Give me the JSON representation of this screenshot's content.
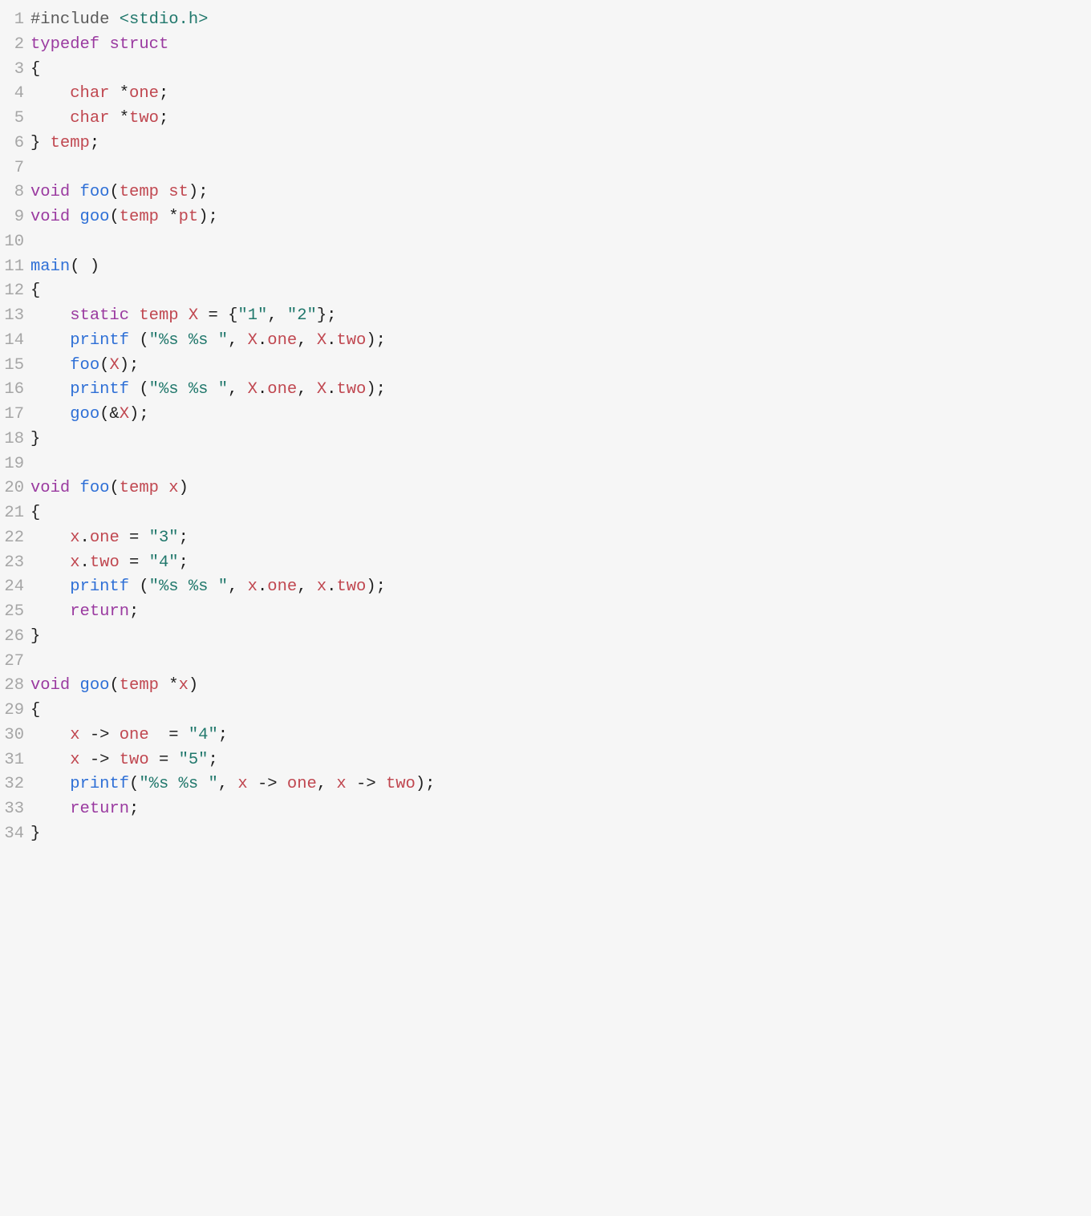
{
  "code": {
    "lines": [
      {
        "n": "1",
        "tokens": [
          [
            "preproc",
            "#include"
          ],
          [
            "punct",
            " "
          ],
          [
            "include",
            "<stdio.h>"
          ]
        ]
      },
      {
        "n": "2",
        "tokens": [
          [
            "keyword",
            "typedef"
          ],
          [
            "punct",
            " "
          ],
          [
            "keyword",
            "struct"
          ]
        ]
      },
      {
        "n": "3",
        "tokens": [
          [
            "punct",
            "{"
          ]
        ]
      },
      {
        "n": "4",
        "tokens": [
          [
            "punct",
            "    "
          ],
          [
            "type",
            "char"
          ],
          [
            "punct",
            " *"
          ],
          [
            "var",
            "one"
          ],
          [
            "punct",
            ";"
          ]
        ]
      },
      {
        "n": "5",
        "tokens": [
          [
            "punct",
            "    "
          ],
          [
            "type",
            "char"
          ],
          [
            "punct",
            " *"
          ],
          [
            "var",
            "two"
          ],
          [
            "punct",
            ";"
          ]
        ]
      },
      {
        "n": "6",
        "tokens": [
          [
            "punct",
            "} "
          ],
          [
            "type",
            "temp"
          ],
          [
            "punct",
            ";"
          ]
        ]
      },
      {
        "n": "7",
        "tokens": []
      },
      {
        "n": "8",
        "tokens": [
          [
            "keyword",
            "void"
          ],
          [
            "punct",
            " "
          ],
          [
            "func",
            "foo"
          ],
          [
            "punct",
            "("
          ],
          [
            "type",
            "temp"
          ],
          [
            "punct",
            " "
          ],
          [
            "var",
            "st"
          ],
          [
            "punct",
            ");"
          ]
        ]
      },
      {
        "n": "9",
        "tokens": [
          [
            "keyword",
            "void"
          ],
          [
            "punct",
            " "
          ],
          [
            "func",
            "goo"
          ],
          [
            "punct",
            "("
          ],
          [
            "type",
            "temp"
          ],
          [
            "punct",
            " *"
          ],
          [
            "var",
            "pt"
          ],
          [
            "punct",
            ");"
          ]
        ]
      },
      {
        "n": "10",
        "tokens": []
      },
      {
        "n": "11",
        "tokens": [
          [
            "func",
            "main"
          ],
          [
            "punct",
            "( )"
          ]
        ]
      },
      {
        "n": "12",
        "tokens": [
          [
            "punct",
            "{"
          ]
        ]
      },
      {
        "n": "13",
        "tokens": [
          [
            "punct",
            "    "
          ],
          [
            "keyword",
            "static"
          ],
          [
            "punct",
            " "
          ],
          [
            "type",
            "temp"
          ],
          [
            "punct",
            " "
          ],
          [
            "var",
            "X"
          ],
          [
            "punct",
            " = {"
          ],
          [
            "string",
            "\"1\""
          ],
          [
            "punct",
            ", "
          ],
          [
            "string",
            "\"2\""
          ],
          [
            "punct",
            "};"
          ]
        ]
      },
      {
        "n": "14",
        "tokens": [
          [
            "punct",
            "    "
          ],
          [
            "func",
            "printf"
          ],
          [
            "punct",
            " ("
          ],
          [
            "string",
            "\"%s %s \""
          ],
          [
            "punct",
            ", "
          ],
          [
            "var",
            "X"
          ],
          [
            "punct",
            "."
          ],
          [
            "var",
            "one"
          ],
          [
            "punct",
            ", "
          ],
          [
            "var",
            "X"
          ],
          [
            "punct",
            "."
          ],
          [
            "var",
            "two"
          ],
          [
            "punct",
            ");"
          ]
        ]
      },
      {
        "n": "15",
        "tokens": [
          [
            "punct",
            "    "
          ],
          [
            "func",
            "foo"
          ],
          [
            "punct",
            "("
          ],
          [
            "var",
            "X"
          ],
          [
            "punct",
            ");"
          ]
        ]
      },
      {
        "n": "16",
        "tokens": [
          [
            "punct",
            "    "
          ],
          [
            "func",
            "printf"
          ],
          [
            "punct",
            " ("
          ],
          [
            "string",
            "\"%s %s \""
          ],
          [
            "punct",
            ", "
          ],
          [
            "var",
            "X"
          ],
          [
            "punct",
            "."
          ],
          [
            "var",
            "one"
          ],
          [
            "punct",
            ", "
          ],
          [
            "var",
            "X"
          ],
          [
            "punct",
            "."
          ],
          [
            "var",
            "two"
          ],
          [
            "punct",
            ");"
          ]
        ]
      },
      {
        "n": "17",
        "tokens": [
          [
            "punct",
            "    "
          ],
          [
            "func",
            "goo"
          ],
          [
            "punct",
            "(&"
          ],
          [
            "var",
            "X"
          ],
          [
            "punct",
            ");"
          ]
        ]
      },
      {
        "n": "18",
        "tokens": [
          [
            "punct",
            "}"
          ]
        ]
      },
      {
        "n": "19",
        "tokens": []
      },
      {
        "n": "20",
        "tokens": [
          [
            "keyword",
            "void"
          ],
          [
            "punct",
            " "
          ],
          [
            "func",
            "foo"
          ],
          [
            "punct",
            "("
          ],
          [
            "type",
            "temp"
          ],
          [
            "punct",
            " "
          ],
          [
            "var",
            "x"
          ],
          [
            "punct",
            ")"
          ]
        ]
      },
      {
        "n": "21",
        "tokens": [
          [
            "punct",
            "{"
          ]
        ]
      },
      {
        "n": "22",
        "tokens": [
          [
            "punct",
            "    "
          ],
          [
            "var",
            "x"
          ],
          [
            "punct",
            "."
          ],
          [
            "var",
            "one"
          ],
          [
            "punct",
            " = "
          ],
          [
            "string",
            "\"3\""
          ],
          [
            "punct",
            ";"
          ]
        ]
      },
      {
        "n": "23",
        "tokens": [
          [
            "punct",
            "    "
          ],
          [
            "var",
            "x"
          ],
          [
            "punct",
            "."
          ],
          [
            "var",
            "two"
          ],
          [
            "punct",
            " = "
          ],
          [
            "string",
            "\"4\""
          ],
          [
            "punct",
            ";"
          ]
        ]
      },
      {
        "n": "24",
        "tokens": [
          [
            "punct",
            "    "
          ],
          [
            "func",
            "printf"
          ],
          [
            "punct",
            " ("
          ],
          [
            "string",
            "\"%s %s \""
          ],
          [
            "punct",
            ", "
          ],
          [
            "var",
            "x"
          ],
          [
            "punct",
            "."
          ],
          [
            "var",
            "one"
          ],
          [
            "punct",
            ", "
          ],
          [
            "var",
            "x"
          ],
          [
            "punct",
            "."
          ],
          [
            "var",
            "two"
          ],
          [
            "punct",
            ");"
          ]
        ]
      },
      {
        "n": "25",
        "tokens": [
          [
            "punct",
            "    "
          ],
          [
            "keyword",
            "return"
          ],
          [
            "punct",
            ";"
          ]
        ]
      },
      {
        "n": "26",
        "tokens": [
          [
            "punct",
            "}"
          ]
        ]
      },
      {
        "n": "27",
        "tokens": []
      },
      {
        "n": "28",
        "tokens": [
          [
            "keyword",
            "void"
          ],
          [
            "punct",
            " "
          ],
          [
            "func",
            "goo"
          ],
          [
            "punct",
            "("
          ],
          [
            "type",
            "temp"
          ],
          [
            "punct",
            " *"
          ],
          [
            "var",
            "x"
          ],
          [
            "punct",
            ")"
          ]
        ]
      },
      {
        "n": "29",
        "tokens": [
          [
            "punct",
            "{"
          ]
        ]
      },
      {
        "n": "30",
        "tokens": [
          [
            "punct",
            "    "
          ],
          [
            "var",
            "x"
          ],
          [
            "punct",
            " -> "
          ],
          [
            "var",
            "one"
          ],
          [
            "punct",
            "  = "
          ],
          [
            "string",
            "\"4\""
          ],
          [
            "punct",
            ";"
          ]
        ]
      },
      {
        "n": "31",
        "tokens": [
          [
            "punct",
            "    "
          ],
          [
            "var",
            "x"
          ],
          [
            "punct",
            " -> "
          ],
          [
            "var",
            "two"
          ],
          [
            "punct",
            " = "
          ],
          [
            "string",
            "\"5\""
          ],
          [
            "punct",
            ";"
          ]
        ]
      },
      {
        "n": "32",
        "tokens": [
          [
            "punct",
            "    "
          ],
          [
            "func",
            "printf"
          ],
          [
            "punct",
            "("
          ],
          [
            "string",
            "\"%s %s \""
          ],
          [
            "punct",
            ", "
          ],
          [
            "var",
            "x"
          ],
          [
            "punct",
            " -> "
          ],
          [
            "var",
            "one"
          ],
          [
            "punct",
            ", "
          ],
          [
            "var",
            "x"
          ],
          [
            "punct",
            " -> "
          ],
          [
            "var",
            "two"
          ],
          [
            "punct",
            ");"
          ]
        ]
      },
      {
        "n": "33",
        "tokens": [
          [
            "punct",
            "    "
          ],
          [
            "keyword",
            "return"
          ],
          [
            "punct",
            ";"
          ]
        ]
      },
      {
        "n": "34",
        "tokens": [
          [
            "punct",
            "}"
          ]
        ]
      }
    ]
  }
}
